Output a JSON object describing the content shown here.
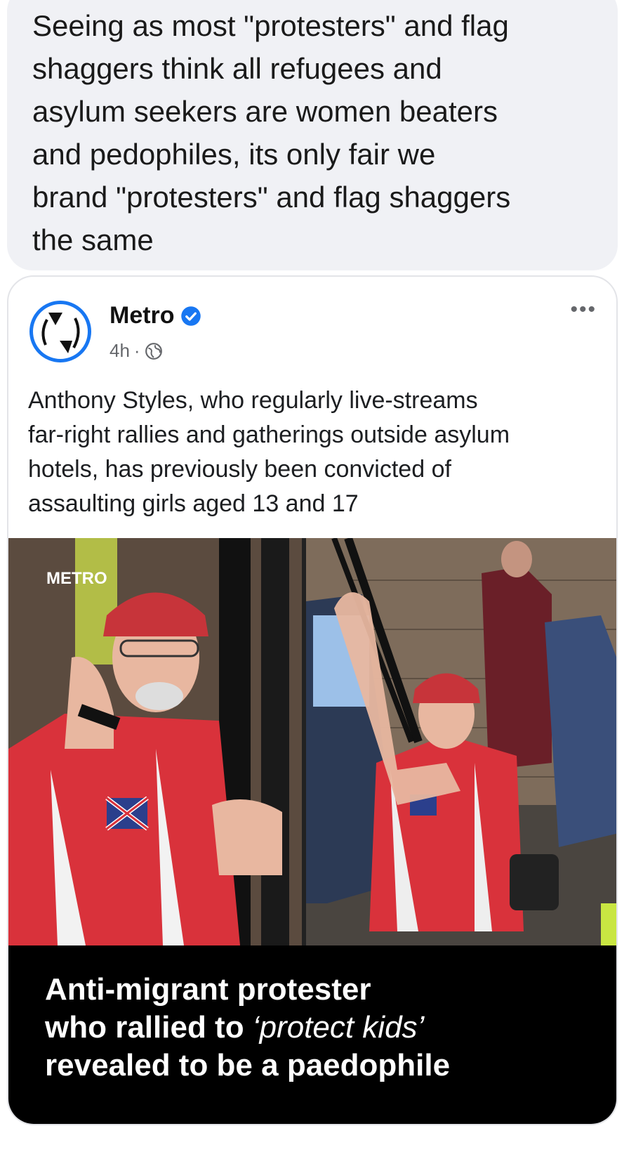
{
  "comment": {
    "text": "Seeing as most \"protesters\" and flag\nshaggers think all refugees and\nasylum seekers are women beaters\nand pedophiles,  its only fair we\nbrand \"protesters\" and flag shaggers\nthe same"
  },
  "post": {
    "page_name": "Metro",
    "timestamp": "4h",
    "separator": "·",
    "more_label": "•••",
    "body": "Anthony Styles, who regularly live-streams\nfar-right rallies and gatherings outside asylum\nhotels, has previously been convicted of\nassaulting girls aged 13 and 17",
    "watermark": "METRO",
    "headline_line1": "Anti-migrant protester",
    "headline_line2_prefix": "who rallied to ",
    "headline_line2_italic": "‘protect kids’",
    "headline_line3": "revealed to be a paedophile"
  },
  "colors": {
    "accent": "#1877f2",
    "bubble_bg": "#f0f1f5",
    "caption_bg": "#000000"
  },
  "icons": {
    "verified": "verified-badge-icon",
    "audience": "globe-icon",
    "more": "more-options-icon"
  }
}
